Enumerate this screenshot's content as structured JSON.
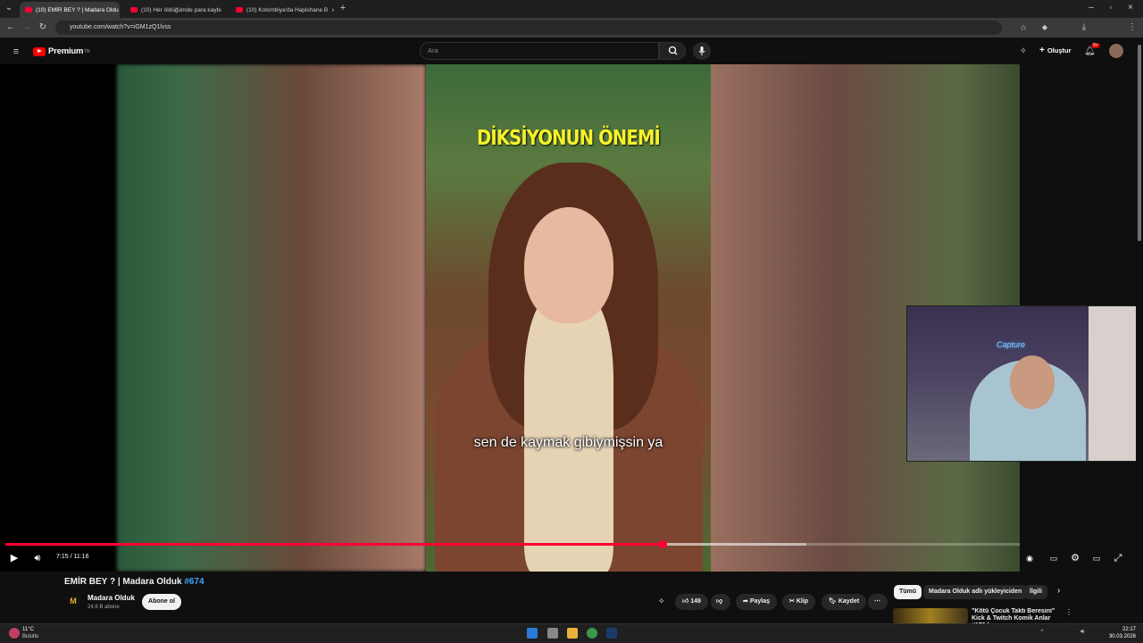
{
  "browser": {
    "tabs": [
      {
        "label": "(10) EMİR BEY ? | Madara Oldu",
        "active": true
      },
      {
        "label": "(10) Her öldüğümde para kaybı",
        "active": false
      },
      {
        "label": "(10) Kolombiya'da Hapishane B",
        "active": false
      }
    ],
    "url": "youtube.com/watch?v=iGM1zQ1lvss"
  },
  "masthead": {
    "logo": "Premium",
    "logo_region": "TR",
    "search_placeholder": "Ara",
    "create_label": "Oluştur",
    "notif_count": "9+"
  },
  "video": {
    "overlay_title": "DİKSİYONUN ÖNEMİ",
    "subtitle": "sen de kaymak gibiymişsin ya",
    "watermark": "M",
    "time": "7:15 / 11:16",
    "progress_fraction": 0.6479,
    "buffered_fraction": 0.79
  },
  "webcam": {
    "neon_sign": "Capture"
  },
  "details": {
    "title": "EMİR BEY ? | Madara Olduk",
    "hashtag": "#674",
    "channel_name": "Madara Olduk",
    "channel_avatar": "M",
    "subscribers": "24,6 B abone",
    "subscribe_label": "Abone ol",
    "likes": "149",
    "share_label": "Paylaş",
    "clip_label": "Klip",
    "save_label": "Kaydet"
  },
  "sidebar": {
    "chips": [
      "Tümü",
      "Madara Olduk adlı yükleyiciden",
      "İlgili"
    ],
    "recommendation_title": "\"Kötü Çocuk Taktı Beresini\" Kick & Twitch Komik Anlar #179 |"
  },
  "taskbar": {
    "temperature": "11°C",
    "weather": "Bulutlu",
    "time": "22:17",
    "date": "30.03.2026"
  }
}
